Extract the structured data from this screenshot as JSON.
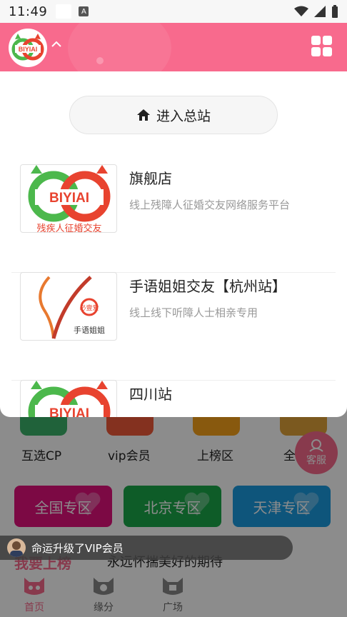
{
  "status_bar": {
    "time": "11:49",
    "a_badge": "A"
  },
  "header": {
    "logo_text": "BIYIAI"
  },
  "panel": {
    "enter_label": "进入总站",
    "stations": [
      {
        "title": "旗舰店",
        "desc": "线上残障人征婚交友网络服务平台",
        "thumb_text": "BIYIAI",
        "thumb_sub": "残疾人征婚交友"
      },
      {
        "title": "手语姐姐交友【杭州站】",
        "desc": "线上线下听障人士相亲专用",
        "thumb_text": "必壹爱",
        "thumb_sub": "手语姐姐"
      },
      {
        "title": "四川站",
        "desc": "",
        "thumb_text": "BIYIAI",
        "thumb_sub": ""
      }
    ]
  },
  "background": {
    "icons": [
      {
        "label": "互选CP",
        "color": "#3bb36a"
      },
      {
        "label": "vip会员",
        "color": "#f05a3a"
      },
      {
        "label": "上榜区",
        "color": "#f7a21b"
      },
      {
        "label": "全",
        "color": "#e0a33a"
      }
    ],
    "zones": [
      {
        "label": "全国专区",
        "color": "#e2127d"
      },
      {
        "label": "北京专区",
        "color": "#1aa84a"
      },
      {
        "label": "天津专区",
        "color": "#1a9be0"
      }
    ],
    "headline": "我要上榜",
    "slogan": "永远怀揣美好的期待"
  },
  "service": {
    "label": "客服"
  },
  "toast": {
    "text": "命运升级了VIP会员"
  },
  "bottom_nav": [
    {
      "label": "首页",
      "active": true
    },
    {
      "label": "缘分",
      "active": false
    },
    {
      "label": "广场",
      "active": false
    }
  ],
  "colors": {
    "brand_pink": "#f86a8d"
  }
}
